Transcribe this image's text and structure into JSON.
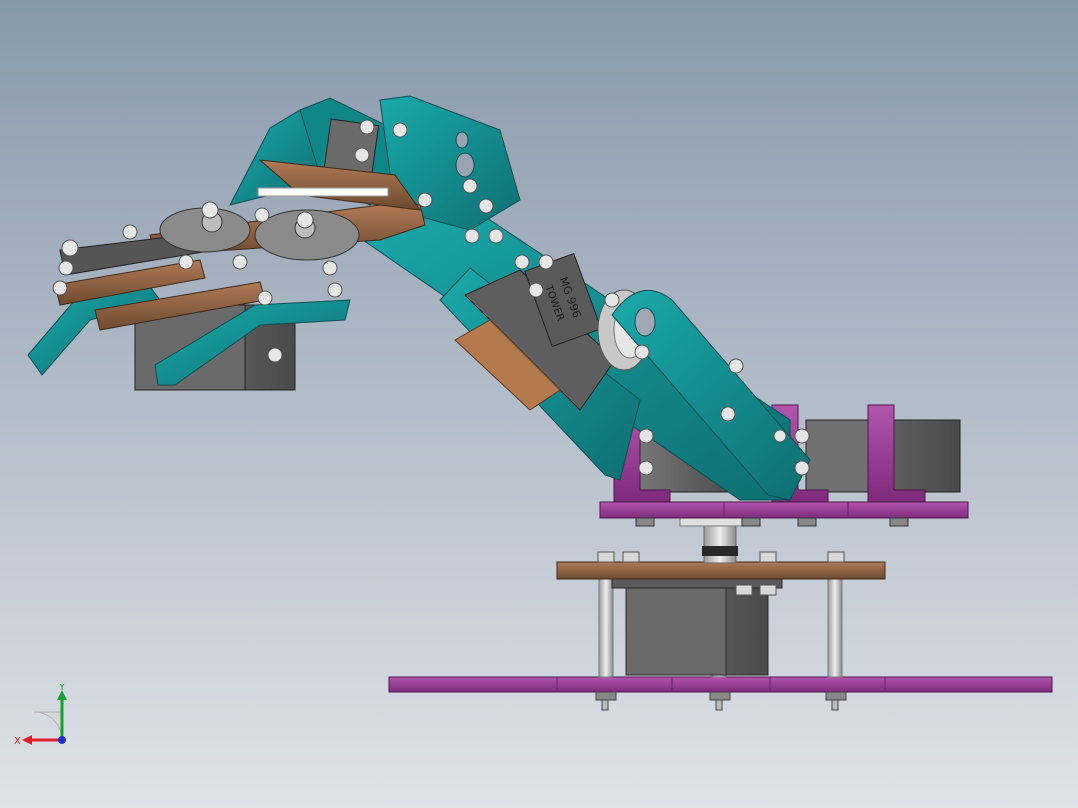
{
  "viewport": {
    "colors": {
      "background_top": "#8898ab",
      "background_bottom": "#dfe3e8",
      "arm_panels": "#139395",
      "brackets": "#a0399c",
      "wood_plates": "#9a6845",
      "servos": "#5d5d5d",
      "gripper_gears": "#8a8a8a"
    }
  },
  "model": {
    "servo_label_top": "MG 996",
    "servo_label_bottom": "TOWER"
  },
  "triad": {
    "x_label": "X",
    "y_label": "Y",
    "x_color": "#e0202a",
    "y_color": "#1aa032",
    "z_color": "#2030d0"
  }
}
